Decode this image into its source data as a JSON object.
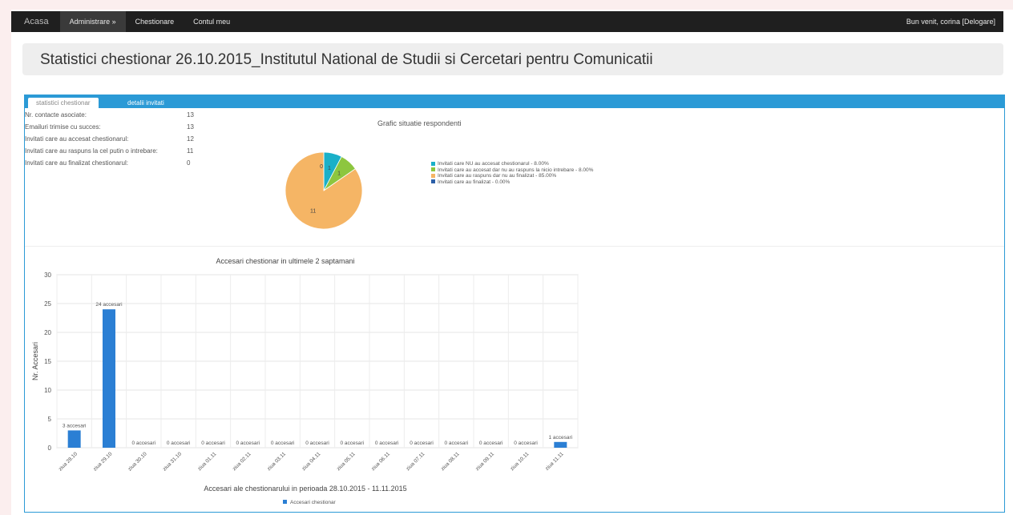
{
  "nav": {
    "brand": "Acasa",
    "items": [
      {
        "label": "Administrare »"
      },
      {
        "label": "Chestionare"
      },
      {
        "label": "Contul meu"
      }
    ],
    "welcome": "Bun venit, corina",
    "logout": "[Delogare]"
  },
  "page": {
    "title": "Statistici chestionar 26.10.2015_Institutul National de Studii si Cercetari pentru Comunicatii"
  },
  "tabs": [
    {
      "label": "statistici chestionar"
    },
    {
      "label": "detalii invitati"
    }
  ],
  "stats": [
    {
      "label": "Nr. contacte asociate:",
      "value": "13"
    },
    {
      "label": "Emailuri trimise cu succes:",
      "value": "13"
    },
    {
      "label": "Invitati care au accesat chestionarul:",
      "value": "12"
    },
    {
      "label": "Invitati care au raspuns la cel putin o intrebare:",
      "value": "11"
    },
    {
      "label": "Invitati care au finalizat chestionarul:",
      "value": "0"
    }
  ],
  "chart_data": [
    {
      "type": "pie",
      "title": "Grafic situatie respondenti",
      "slices": [
        {
          "label": "Invitati care NU au accesat chestionarul - 8.00%",
          "value": 1,
          "color": "#1ab0c8"
        },
        {
          "label": "Invitati care au accesat dar nu au raspuns la nicio intrebare - 8.00%",
          "value": 1,
          "color": "#8dc63f"
        },
        {
          "label": "Invitati care au raspuns dar nu au finalizat - 85.00%",
          "value": 11,
          "color": "#f5b565"
        },
        {
          "label": "Invitati care au finalizat - 0.00%",
          "value": 0,
          "color": "#2c5fa8"
        }
      ],
      "legend": "right"
    },
    {
      "type": "bar",
      "title": "Accesari chestionar in ultimele 2 saptamani",
      "xlabel": "Accesari ale chestionarului in perioada 28.10.2015 - 11.11.2015",
      "ylabel": "Nr. Accesari",
      "ylim": [
        0,
        30
      ],
      "yticks": [
        0,
        5,
        10,
        15,
        20,
        25,
        30
      ],
      "categories": [
        "ziua 28.10",
        "ziua 29.10",
        "ziua 30.10",
        "ziua 31.10",
        "ziua 01.11",
        "ziua 02.11",
        "ziua 03.11",
        "ziua 04.11",
        "ziua 05.11",
        "ziua 06.11",
        "ziua 07.11",
        "ziua 08.11",
        "ziua 09.11",
        "ziua 10.11",
        "ziua 11.11"
      ],
      "series": [
        {
          "name": "Accesari chestionar",
          "color": "#2b7fd4",
          "values": [
            3,
            24,
            0,
            0,
            0,
            0,
            0,
            0,
            0,
            0,
            0,
            0,
            0,
            0,
            1
          ],
          "data_labels": [
            "3 accesari",
            "24 accesari",
            "0 accesari",
            "0 accesari",
            "0 accesari",
            "0 accesari",
            "0 accesari",
            "0 accesari",
            "0 accesari",
            "0 accesari",
            "0 accesari",
            "0 accesari",
            "0 accesari",
            "0 accesari",
            "1 accesari"
          ]
        }
      ],
      "grid": true,
      "legend": "bottom"
    }
  ]
}
